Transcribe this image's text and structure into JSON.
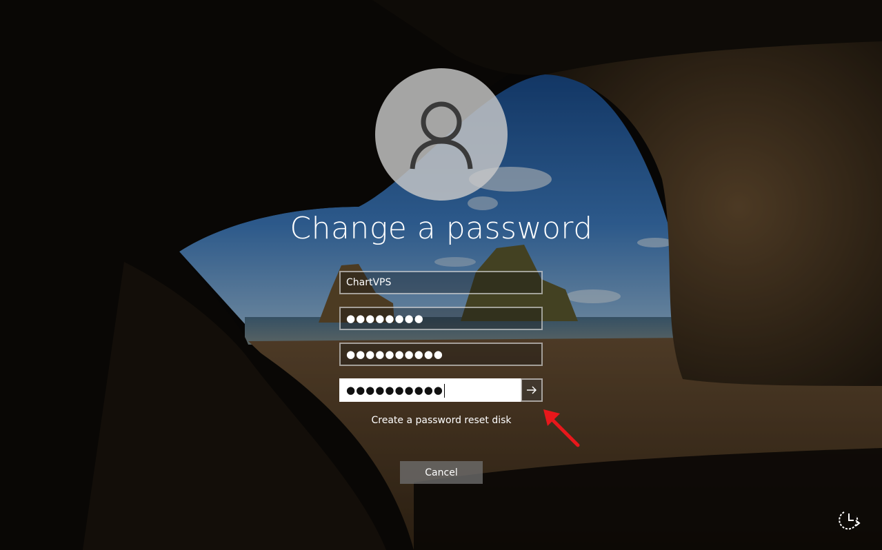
{
  "screen": {
    "title": "Change a password"
  },
  "form": {
    "username_value": "ChartVPS",
    "old_password_value": "●●●●●●●●",
    "new_password_value": "●●●●●●●●●●",
    "confirm_password_value": "●●●●●●●●●●"
  },
  "links": {
    "reset_disk": "Create a password reset disk"
  },
  "buttons": {
    "cancel": "Cancel"
  },
  "icons": {
    "avatar": "user-icon",
    "submit": "arrow-right-icon",
    "corner": "ease-of-access-icon",
    "annotation": "red-arrow-icon"
  },
  "colors": {
    "annotation_arrow": "#e8171b",
    "field_active_bg": "#ffffff",
    "cancel_bg": "#6e6e6e"
  }
}
